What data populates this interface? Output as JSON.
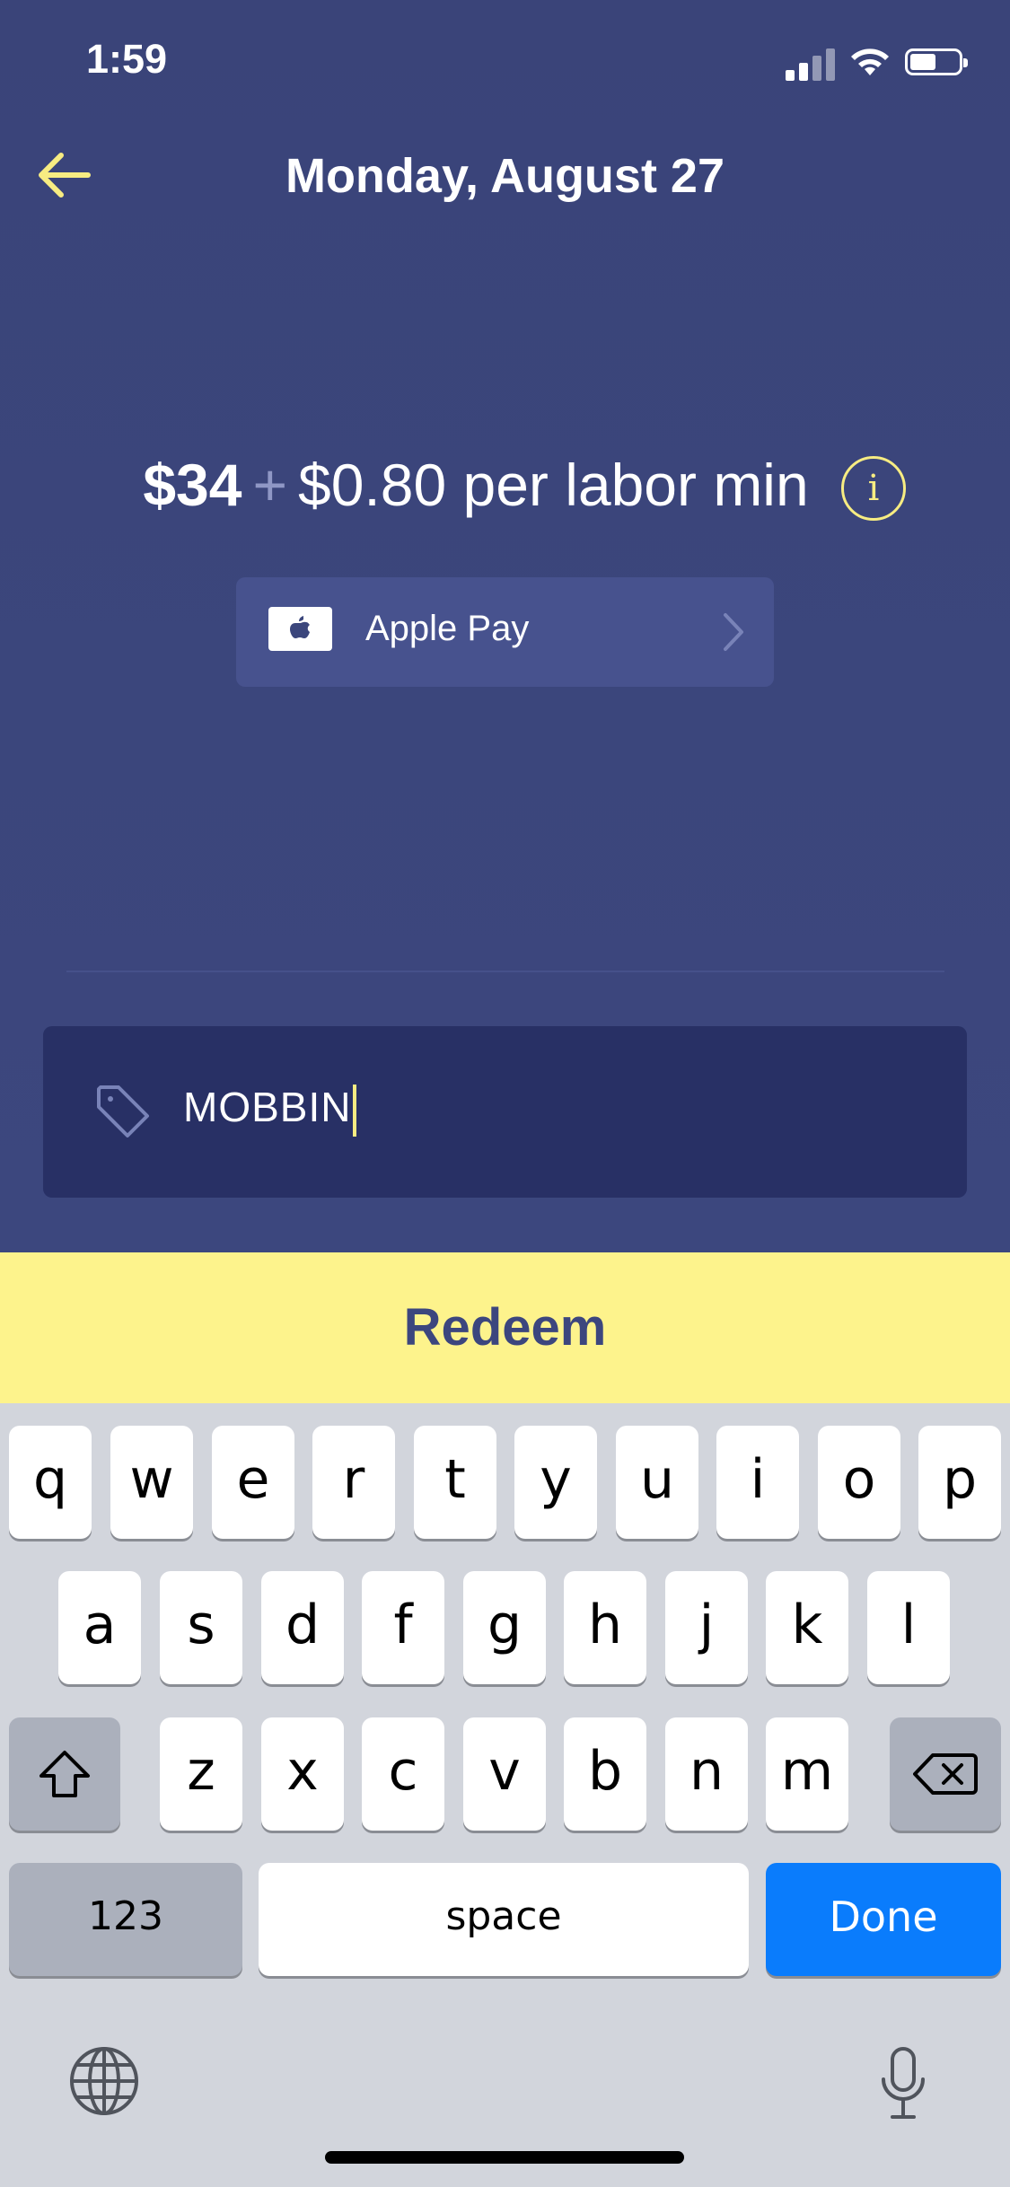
{
  "status_bar": {
    "time": "1:59"
  },
  "header": {
    "title": "Monday, August 27",
    "back_icon": "arrow-left-icon"
  },
  "pricing": {
    "base": "$34",
    "plus": "+",
    "rate": "$0.80 per labor min",
    "info_icon_text": "i"
  },
  "payment": {
    "method_label": "Apple Pay",
    "logo_icon": "apple-logo-icon",
    "chevron_icon": "chevron-right-icon"
  },
  "promo": {
    "icon": "tag-icon",
    "value": "MOBBIN"
  },
  "redeem": {
    "label": "Redeem"
  },
  "keyboard": {
    "row1": [
      "q",
      "w",
      "e",
      "r",
      "t",
      "y",
      "u",
      "i",
      "o",
      "p"
    ],
    "row2": [
      "a",
      "s",
      "d",
      "f",
      "g",
      "h",
      "j",
      "k",
      "l"
    ],
    "row3": [
      "z",
      "x",
      "c",
      "v",
      "b",
      "n",
      "m"
    ],
    "numbers_label": "123",
    "space_label": "space",
    "done_label": "Done"
  },
  "colors": {
    "background": "#3b467c",
    "accent_yellow": "#fdf38c",
    "done_blue": "#0a7cfc",
    "field_bg": "#283065"
  }
}
